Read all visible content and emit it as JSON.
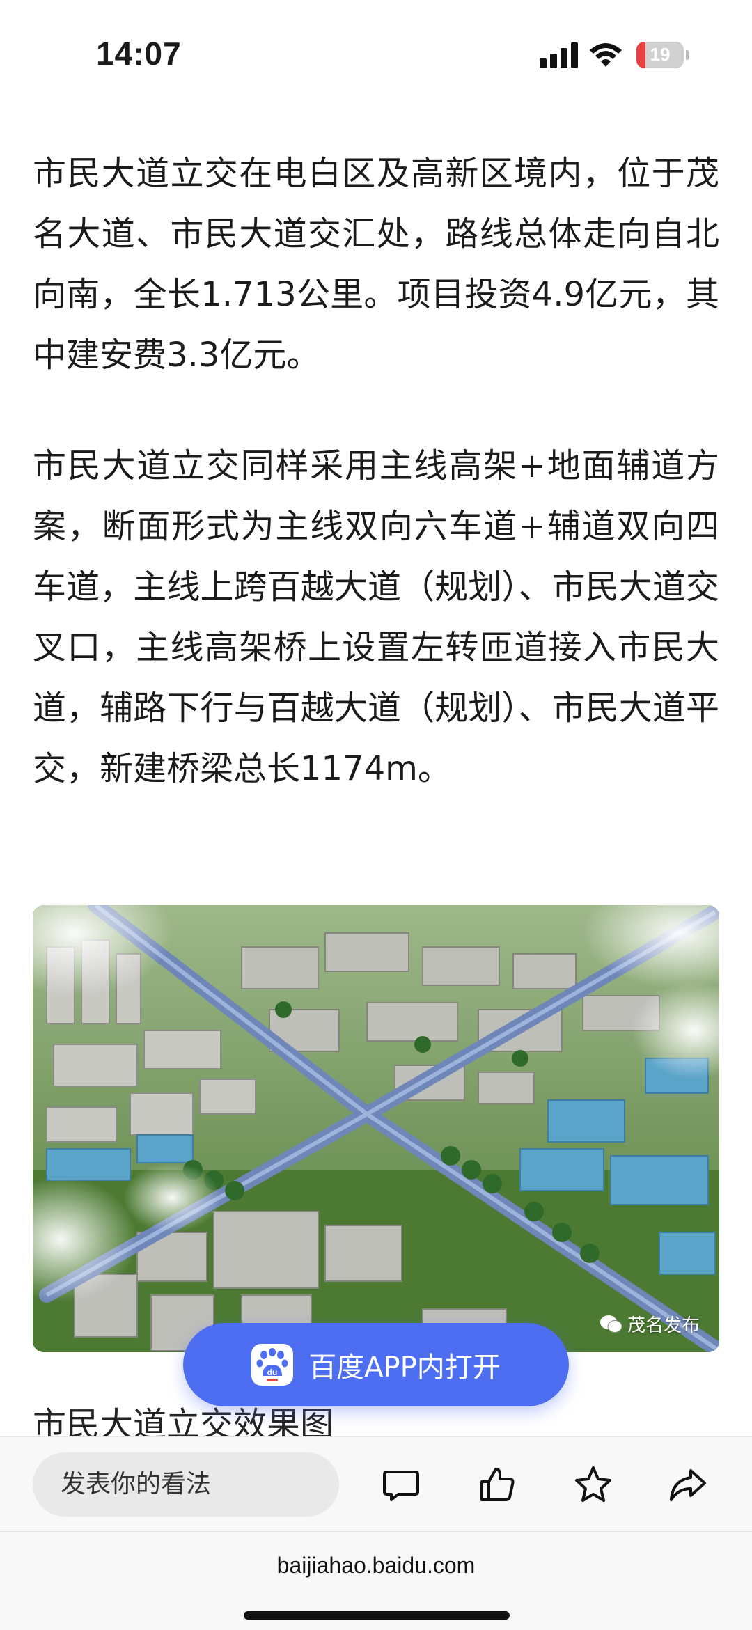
{
  "status_bar": {
    "time": "14:07",
    "battery": "19",
    "battery_level": 0.19
  },
  "article": {
    "paragraphs": [
      "市民大道立交在电白区及高新区境内，位于茂名大道、市民大道交汇处，路线总体走向自北向南，全长1.713公里。项目投资4.9亿元，其中建安费3.3亿元。",
      "市民大道立交同样采用主线高架+地面辅道方案，断面形式为主线双向六车道+辅道双向四车道，主线上跨百越大道（规划）、市民大道交叉口，主线高架桥上设置左转匝道接入市民大道，辅路下行与百越大道（规划）、市民大道平交，新建桥梁总长1174m。"
    ],
    "image_watermark": "茂名发布",
    "caption": "市民大道立交效果图"
  },
  "open_app_button": {
    "label": "百度APP内打开",
    "icon_text": "du"
  },
  "action_bar": {
    "comment_placeholder": "发表你的看法",
    "icons": [
      "comment-icon",
      "like-icon",
      "favorite-star-icon",
      "share-icon"
    ]
  },
  "url_bar": {
    "url": "baijiahao.baidu.com"
  },
  "colors": {
    "accent": "#4e6ef2",
    "battery_low": "#e64040"
  }
}
